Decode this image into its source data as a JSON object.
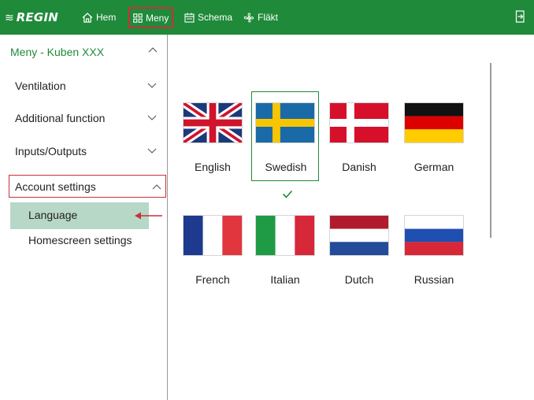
{
  "topbar": {
    "brand": "REGIN",
    "nav": [
      {
        "label": "Hem",
        "icon": "home-icon"
      },
      {
        "label": "Meny",
        "icon": "grid-icon",
        "active": true
      },
      {
        "label": "Schema",
        "icon": "calendar-icon"
      },
      {
        "label": "Fläkt",
        "icon": "fan-icon"
      }
    ],
    "logout_icon": "logout-icon"
  },
  "sidebar": {
    "title": "Meny - Kuben XXX",
    "items": [
      {
        "label": "Ventilation",
        "expanded": false
      },
      {
        "label": "Additional function",
        "expanded": false
      },
      {
        "label": "Inputs/Outputs",
        "expanded": false
      },
      {
        "label": "Account settings",
        "expanded": true,
        "children": [
          {
            "label": "Language",
            "selected": true
          },
          {
            "label": "Homescreen settings",
            "selected": false
          }
        ]
      }
    ]
  },
  "languages": [
    {
      "name": "English",
      "flag": "uk-flag-icon",
      "selected": false
    },
    {
      "name": "Swedish",
      "flag": "sweden-flag-icon",
      "selected": true
    },
    {
      "name": "Danish",
      "flag": "denmark-flag-icon",
      "selected": false
    },
    {
      "name": "German",
      "flag": "germany-flag-icon",
      "selected": false
    },
    {
      "name": "French",
      "flag": "france-flag-icon",
      "selected": false
    },
    {
      "name": "Italian",
      "flag": "italy-flag-icon",
      "selected": false
    },
    {
      "name": "Dutch",
      "flag": "netherlands-flag-icon",
      "selected": false
    },
    {
      "name": "Russian",
      "flag": "russia-flag-icon",
      "selected": false
    }
  ],
  "colors": {
    "brand_green": "#1f8a3a",
    "highlight_red": "#c4323a",
    "selected_bg": "#b8d8c7"
  }
}
